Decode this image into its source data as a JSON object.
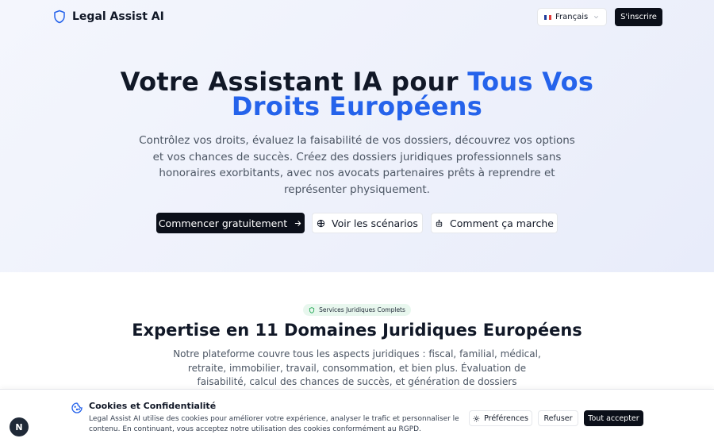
{
  "header": {
    "brand_name": "Legal Assist AI",
    "brand_icon": "shield-icon",
    "language": {
      "label": "Français",
      "icon": "flag-fr-icon",
      "flag_colors": [
        "#1f3c9b",
        "#ffffff",
        "#e23b3b"
      ]
    },
    "signup_label": "S'inscrire"
  },
  "hero": {
    "title_line1_plain": "Votre Assistant IA pour ",
    "title_line1_accent": "Tous Vos",
    "title_line2_accent": "Droits Européens",
    "subtitle": "Contrôlez vos droits, évaluez la faisabilité de vos dossiers, découvrez vos options et vos chances de succès. Créez des dossiers juridiques professionnels sans honoraires exorbitants, avec nos avocats partenaires prêts à reprendre et représenter physiquement.",
    "cta_primary": "Commencer gratuitement",
    "cta_scenarios": "Voir les scénarios",
    "cta_how": "Comment ça marche"
  },
  "services": {
    "badge_label": "Services Juridiques Complets",
    "title": "Expertise en 11 Domaines Juridiques Européens",
    "subtitle": "Notre plateforme couvre tous les aspects juridiques : fiscal, familial, médical, retraite, immobilier, travail, consommation, et bien plus. Évaluation de faisabilité, calcul des chances de succès, et génération de dossiers professionnels."
  },
  "cookie_banner": {
    "title": "Cookies et Confidentialité",
    "text": "Legal Assist AI utilise des cookies pour améliorer votre expérience, analyser le trafic et personnaliser le contenu. En continuant, vous acceptez notre utilisation des cookies conformément au RGPD.",
    "preferences_label": "Préférences",
    "refuse_label": "Refuser",
    "accept_label": "Tout accepter"
  },
  "dev_badge": {
    "label": "N"
  },
  "colors": {
    "accent": "#2563eb",
    "dark": "#0b0f19",
    "badge_bg": "#e8f7ee"
  }
}
